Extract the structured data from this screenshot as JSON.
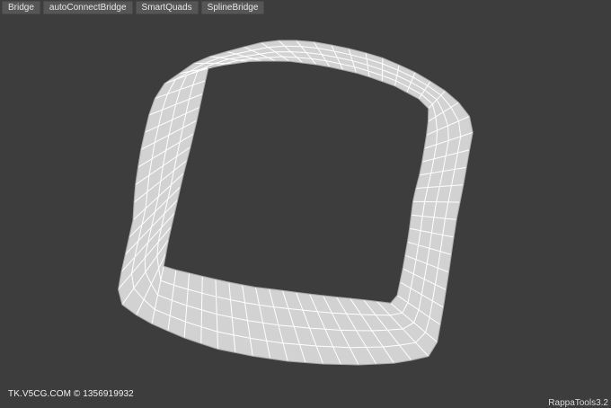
{
  "toolbar": {
    "buttons": [
      {
        "label": "Bridge"
      },
      {
        "label": "autoConnectBridge"
      },
      {
        "label": "SmartQuads"
      },
      {
        "label": "SplineBridge"
      }
    ]
  },
  "viewport": {
    "background": "#3d3d3d",
    "mesh_fill": "#d2d2d2",
    "mesh_wire": "#ffffff",
    "mesh_edge": "#a8a8a8"
  },
  "overlay": {
    "watermark": "TK.V5CG.COM © 1356919932",
    "version": "RappaTools3.2"
  }
}
